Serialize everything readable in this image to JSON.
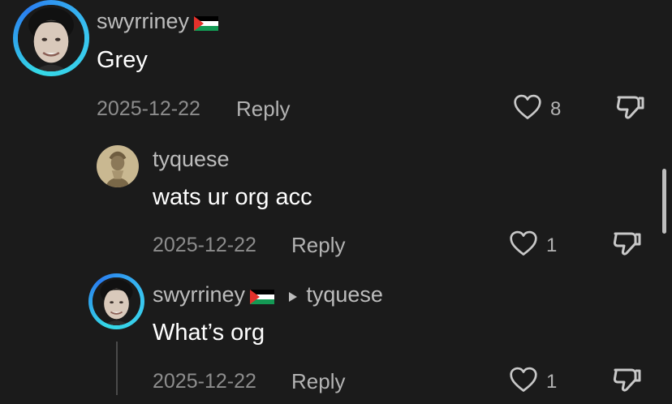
{
  "comments": [
    {
      "username": "swyrriney",
      "text": "Grey",
      "date": "2025-12-22",
      "reply_label": "Reply",
      "like_count": "8"
    },
    {
      "username": "tyquese",
      "text": "wats ur org acc",
      "date": "2025-12-22",
      "reply_label": "Reply",
      "like_count": "1"
    },
    {
      "username": "swyrriney",
      "reply_to": "tyquese",
      "text": "What’s org",
      "date": "2025-12-22",
      "reply_label": "Reply",
      "like_count": "1"
    }
  ],
  "colors": {
    "background": "#1b1b1b",
    "ring_accent": "#35d9e6",
    "username": "#bdbdbd",
    "date": "#8d8d8d"
  },
  "icons": [
    "avatar",
    "palestine-flag-icon",
    "heart-icon",
    "dislike-icon",
    "triangle-right-icon"
  ]
}
